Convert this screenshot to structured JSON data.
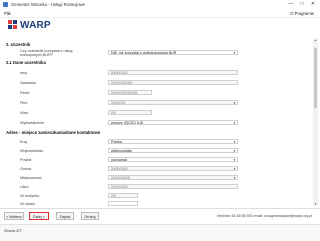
{
  "window": {
    "title": "Generator Wniosku - Usługi Rozwojowe",
    "minimize": "—",
    "maximize": "□",
    "close": "✕"
  },
  "menu": {
    "file": "Plik",
    "about": "O Programie"
  },
  "logo": {
    "text": "WARP"
  },
  "sections": {
    "s2": "2. Uczestnik",
    "s21": "2.1 Dane uczestnika",
    "address": "Adres - miejsce zamieszkania/dane kontaktowe"
  },
  "fields": {
    "consent": {
      "label": "Czy uczestnik korzystał z usług rozwojowych BUR?",
      "value": "NIE, nie korzystał z dofinansowania BUR"
    },
    "imie": {
      "label": "Imię",
      "value": "XXXXXXX"
    },
    "nazwisko": {
      "label": "Nazwisko",
      "value": "XXXXXXXXX"
    },
    "pesel": {
      "label": "Pesel",
      "value": "XXXXXXXXXXX"
    },
    "plec": {
      "label": "Płeć",
      "value": "XXXXXX"
    },
    "wiek": {
      "label": "Wiek",
      "value": "XX"
    },
    "wyksztalcenie": {
      "label": "Wykształcenie",
      "value": "wyższe (ISCED 5-8)"
    },
    "kraj": {
      "label": "Kraj",
      "value": "Polska"
    },
    "wojewodztwo": {
      "label": "Województwo",
      "value": "wielkopolskie"
    },
    "powiat": {
      "label": "Powiat",
      "value": "poznański"
    },
    "gmina": {
      "label": "Gmina",
      "value": "XXXXXXX"
    },
    "miejscowosc": {
      "label": "Miejscowość",
      "value": "XXXXXXXX"
    },
    "ulica": {
      "label": "Ulica",
      "value": "XXXXXXX"
    },
    "nr_budynku": {
      "label": "Nr budynku",
      "value": "XX"
    },
    "nr_lokalu": {
      "label": "Nr lokalu",
      "value": ""
    }
  },
  "footer": {
    "back": "< Wstecz",
    "next": "Dalej >",
    "save": "Zapisz",
    "print": "Drukuj",
    "contact": "Infolinia: 61 65 65 500 email: uslugirozwojowe@warp.org.pl"
  },
  "status": {
    "page": "Strona 2/7"
  },
  "colors": {
    "logo": "#1f3f7a",
    "accent_border": "#dd3333"
  }
}
